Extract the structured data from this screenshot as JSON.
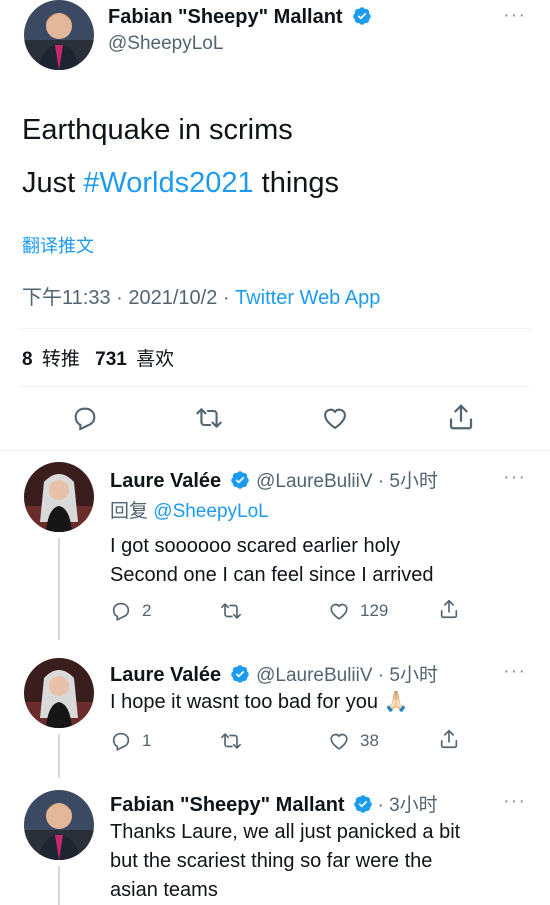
{
  "main_tweet": {
    "author_name": "Fabian \"Sheepy\" Mallant",
    "author_handle": "@SheepyLoL",
    "line1": "Earthquake in scrims",
    "line2_prefix": "Just ",
    "line2_hashtag": "#Worlds2021",
    "line2_suffix": " things",
    "translate_label": "翻译推文",
    "timestamp": "下午11:33 · 2021/10/2 · ",
    "source": "Twitter Web App",
    "retweet_count": "8",
    "retweet_label": "转推",
    "like_count": "731",
    "like_label": "喜欢"
  },
  "replies": [
    {
      "author_name": "Laure Valée",
      "author_handle": "@LaureBuliiV · 5小时",
      "replying_prefix": "回复 ",
      "replying_handle": "@SheepyLoL",
      "lines": [
        "I got soooooo scared earlier holy",
        "Second one I can feel since I arrived"
      ],
      "reply_count": "2",
      "like_count": "129"
    },
    {
      "author_name": "Laure Valée",
      "author_handle": "@LaureBuliiV · 5小时",
      "lines": [
        "I hope it wasnt too bad for you 🙏🏻"
      ],
      "reply_count": "1",
      "like_count": "38"
    },
    {
      "author_name": "Fabian \"Sheepy\" Mallant",
      "author_handle": " · 3小时",
      "lines": [
        "Thanks Laure, we all just panicked a bit",
        "but the scariest thing so far were the",
        "asian teams"
      ]
    }
  ],
  "more_label": "···",
  "colors": {
    "link": "#1d9bf0",
    "verified": "#1d9bf0",
    "muted": "#536471"
  }
}
